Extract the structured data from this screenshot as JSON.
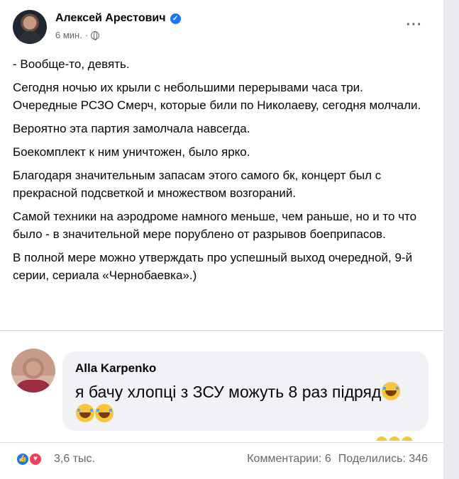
{
  "post": {
    "author": "Алексей Арестович",
    "time": "6 мин.",
    "separator": "·",
    "more_label": "···",
    "paragraphs": [
      "- Вообще-то, девять.",
      "Сегодня ночью их крыли с небольшими перерывами часа три. Очередные РСЗО Смерч, которые били по Николаеву, сегодня молчали.",
      "Вероятно эта партия замолчала навсегда.",
      "Боекомплект к ним уничтожен, было ярко.",
      "Благодаря значительным запасам этого самого бк, концерт был с прекрасной подсветкой и множеством возгораний.",
      "Самой техники на аэродроме намного меньше, чем раньше, но и то что было - в значительной мере порублено от разрывов боеприпасов.",
      "В полной мере можно утверждать про успешный выход очередной, 9-й серии, сериала «Чернобаевка».)"
    ]
  },
  "comment": {
    "author": "Alla Karpenko",
    "text": "я бачу хлопці з ЗСУ можуть 8 раз підряд",
    "emojis": [
      "laughing-crying-icon",
      "laughing-crying-icon",
      "laughing-crying-icon"
    ]
  },
  "footer": {
    "reactions_count": "3,6 тыс.",
    "comments": "Комментарии: 6",
    "shares": "Поделились: 346"
  },
  "colors": {
    "accent": "#1877f2",
    "love": "#f33e58",
    "muted_text": "#65676b",
    "bubble_bg": "#f0f2f5"
  }
}
